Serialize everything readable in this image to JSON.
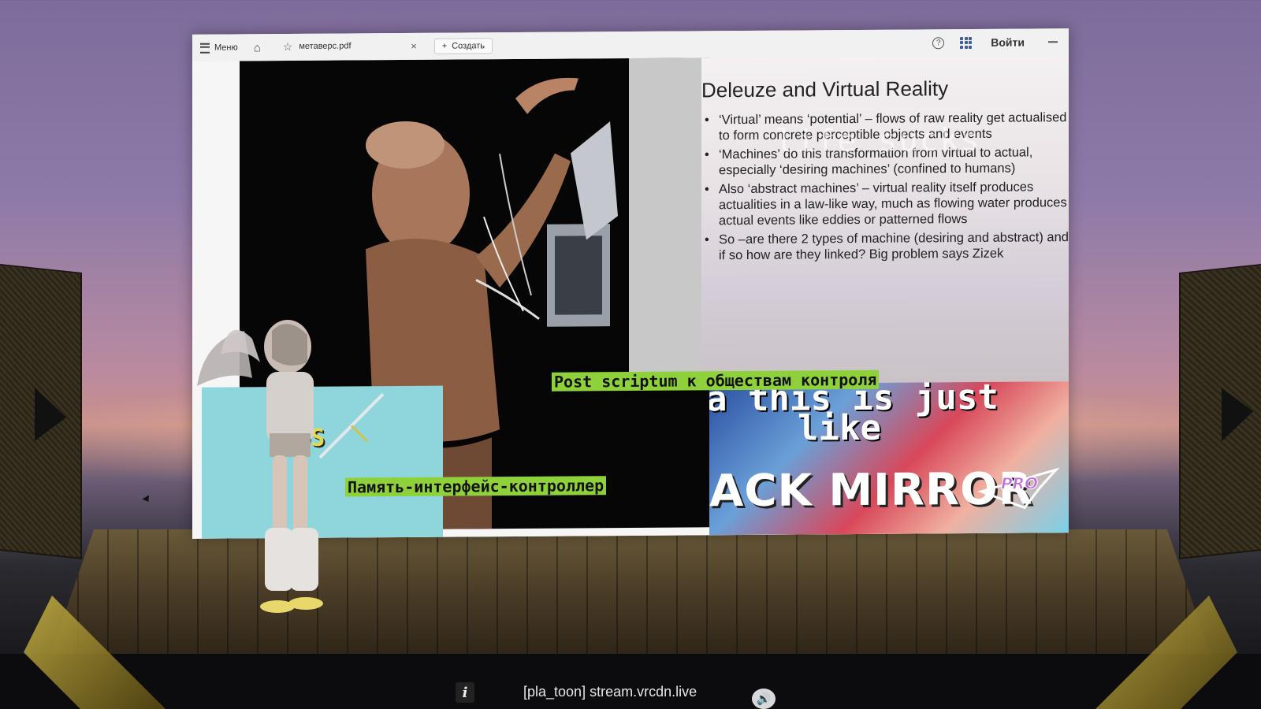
{
  "browser": {
    "menu_label": "Меню",
    "tab_title": "метаверс.pdf",
    "create_label": "Создать",
    "login_label": "Войти"
  },
  "slide": {
    "title": "Deleuze and Virtual Reality",
    "bullets": [
      "‘Virtual’ means ‘potential’ – flows of raw reality get actualised to form concrete perceptible objects and events",
      "‘Machines’ do this transformation from virtual to actual, especially ‘desiring machines’ (confined to humans)",
      "Also ‘abstract machines’ – virtual reality itself produces actualities in a law-like way, much as  flowing water produces actual events like eddies or patterned flows",
      "So –are there 2 types of machine (desiring and abstract) and if so how are they linked? Big problem says Zizek"
    ],
    "ghost_overlay": "life sucks"
  },
  "overlays": {
    "caption_top": "Post scriptum к обществам контроля",
    "caption_bottom": "Память-интерфейс-контроллер",
    "os_text": "leOS",
    "meme_line1": "a this is just",
    "meme_line2": "like",
    "meme_line3": "ACK MIRROR",
    "pro_logo": "PRO"
  },
  "player": {
    "stream_label": "[pla_toon] stream.vrcdn.live",
    "info_glyph": "i",
    "volume_glyph": "🔊"
  },
  "colors": {
    "caption_bg": "#8fd13a",
    "cyan_panel": "#8fd6dc",
    "apps_icon": "#3e5b92"
  }
}
